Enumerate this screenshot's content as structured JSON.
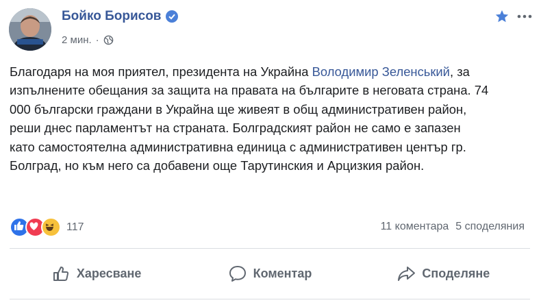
{
  "post": {
    "author": "Бойко Борисов",
    "time": "2 мин.",
    "meta_separator": "·",
    "avatar_caption": "",
    "icons": {
      "verified": "verified-badge-icon",
      "privacy": "globe-icon",
      "favorite": "star-icon",
      "menu": "more-options-icon"
    },
    "text": {
      "part1": "Благодаря на моя приятел, президента на Украйна ",
      "mention": "Володимир Зеленський",
      "part2": ", за изпълнените обещания за защита на правата на българите в неговата страна. 74 000 български граждани в Украйна ще живеят в общ административен район, реши днес парламентът на страната. Болградският район не само е запазен като самостоятелна административна единица с административен център гр. Болград, но към него са добавени още Тарутинския и Арцизкия район."
    },
    "reactions": {
      "types": [
        "like",
        "love",
        "haha"
      ],
      "count": "117"
    },
    "stats": {
      "comments": "11 коментара",
      "shares": "5 споделяния"
    },
    "actions": {
      "like": "Харесване",
      "comment": "Коментар",
      "share": "Споделяне"
    },
    "colors": {
      "author": "#385898",
      "like": "#2e72e9",
      "love": "#f03c52",
      "haha": "#f7c13b",
      "secondary_text": "#606770",
      "divider": "#dadde1"
    }
  }
}
